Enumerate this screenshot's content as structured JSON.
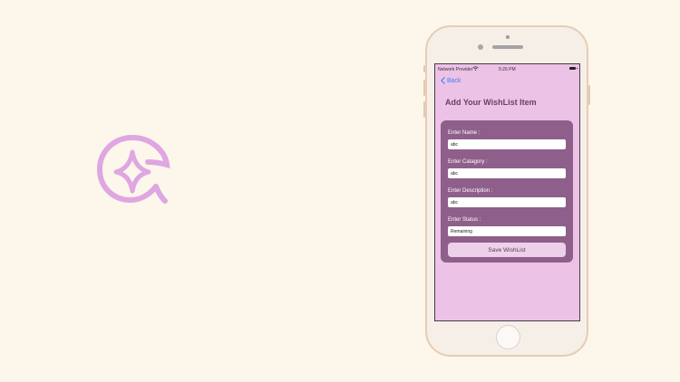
{
  "colors": {
    "background": "#fdf6ea",
    "logo": "#dea6e2",
    "screen": "#ecc2e7",
    "card": "#8f5f8b",
    "accent": "#3b7ff0"
  },
  "logo": {
    "icon": "sparkle-leaf-icon"
  },
  "status_bar": {
    "carrier": "Network Provider",
    "time": "5:26 PM"
  },
  "nav": {
    "back_label": "Back"
  },
  "page": {
    "title": "Add Your WishList Item"
  },
  "form": {
    "name": {
      "label": "Enter Name :",
      "value": "abc"
    },
    "category": {
      "label": "Enter Catagory :",
      "value": "abc"
    },
    "description": {
      "label": "Enter Description :",
      "value": "abc"
    },
    "status": {
      "label": "Enter Status :",
      "value": "Remaining"
    },
    "save_label": "Save WishList"
  }
}
